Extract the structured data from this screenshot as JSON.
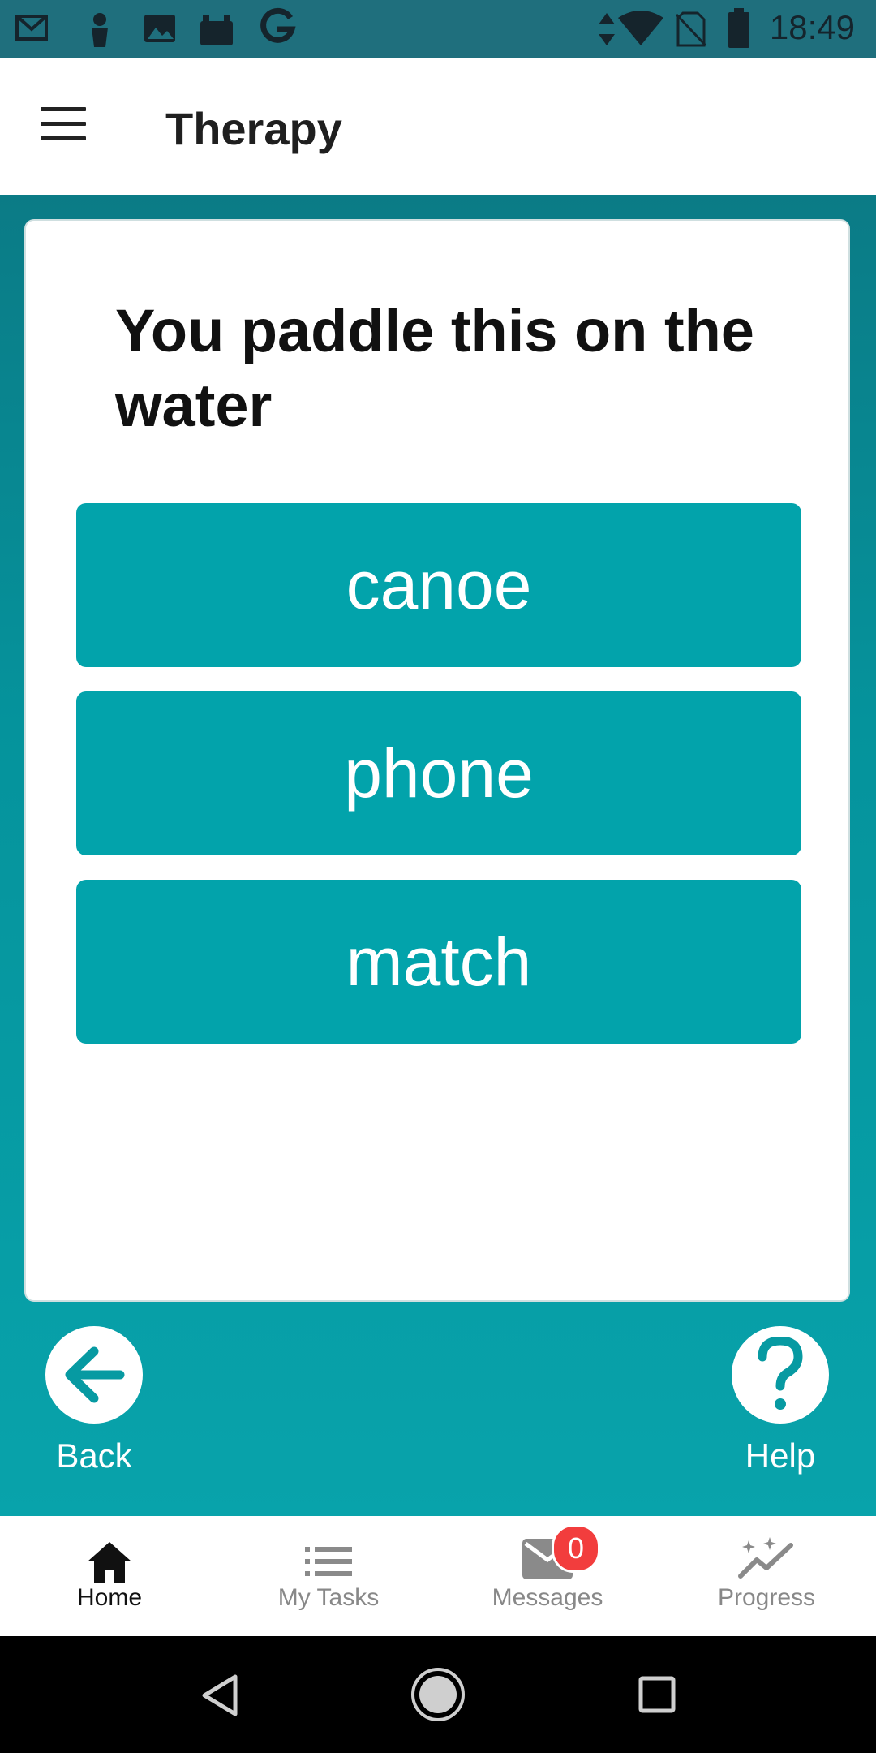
{
  "status_bar": {
    "time": "18:49",
    "left_icons": [
      "gmail-icon",
      "person-icon",
      "image-icon",
      "briefcase-icon",
      "google-icon"
    ],
    "right_icons": [
      "data-arrows-icon",
      "wifi-icon",
      "no-sim-icon",
      "battery-icon"
    ]
  },
  "app_bar": {
    "title": "Therapy",
    "menu_icon": "hamburger-menu-icon"
  },
  "exercise": {
    "question": "You paddle this on the water",
    "answers": [
      "canoe",
      "phone",
      "match"
    ]
  },
  "actions": {
    "back_label": "Back",
    "help_label": "Help"
  },
  "bottom_nav": {
    "items": [
      {
        "label": "Home",
        "icon": "home-icon",
        "active": true
      },
      {
        "label": "My Tasks",
        "icon": "list-icon",
        "active": false
      },
      {
        "label": "Messages",
        "icon": "mail-icon",
        "active": false,
        "badge": "0"
      },
      {
        "label": "Progress",
        "icon": "progress-sparkle-icon",
        "active": false
      }
    ]
  },
  "system_nav": {
    "icons": [
      "back-triangle-icon",
      "home-circle-icon",
      "recents-square-icon"
    ]
  },
  "colors": {
    "status_bar": "#1f6f7d",
    "accent": "#02a3ab",
    "badge": "#f23d3d"
  }
}
